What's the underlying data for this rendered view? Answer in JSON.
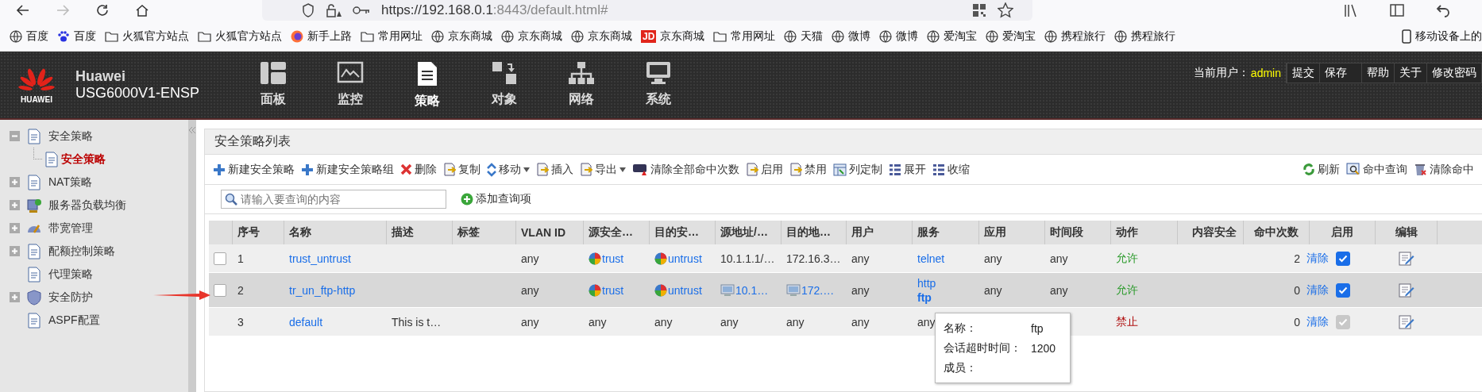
{
  "browser": {
    "address_host": "https://192.168.0.1",
    "address_rest": ":8443/default.html#",
    "forward_disabled": true
  },
  "bookmarks": [
    {
      "kind": "globe",
      "label": "百度"
    },
    {
      "kind": "paw",
      "label": "百度"
    },
    {
      "kind": "folder",
      "label": "火狐官方站点"
    },
    {
      "kind": "folder",
      "label": "火狐官方站点"
    },
    {
      "kind": "fox",
      "label": "新手上路"
    },
    {
      "kind": "folder",
      "label": "常用网址"
    },
    {
      "kind": "globe",
      "label": "京东商城"
    },
    {
      "kind": "globe",
      "label": "京东商城"
    },
    {
      "kind": "globe",
      "label": "京东商城"
    },
    {
      "kind": "jd",
      "label": "京东商城",
      "badge": "JD"
    },
    {
      "kind": "folder",
      "label": "常用网址"
    },
    {
      "kind": "globe",
      "label": "天猫"
    },
    {
      "kind": "globe",
      "label": "微博"
    },
    {
      "kind": "globe",
      "label": "微博"
    },
    {
      "kind": "globe",
      "label": "爱淘宝"
    },
    {
      "kind": "globe",
      "label": "爱淘宝"
    },
    {
      "kind": "globe",
      "label": "携程旅行"
    },
    {
      "kind": "globe",
      "label": "携程旅行"
    }
  ],
  "mobile_bookmarks": "移动设备上的",
  "header": {
    "logo_text": "HUAWEI",
    "brand": "Huawei",
    "model": "USG6000V1-ENSP",
    "nav": [
      {
        "label": "面板",
        "selected": false
      },
      {
        "label": "监控",
        "selected": false
      },
      {
        "label": "策略",
        "selected": true
      },
      {
        "label": "对象",
        "selected": false
      },
      {
        "label": "网络",
        "selected": false
      },
      {
        "label": "系统",
        "selected": false
      }
    ],
    "user_label": "当前用户：",
    "user": "admin",
    "links": [
      "提交",
      "保存",
      "帮助",
      "关于",
      "修改密码"
    ]
  },
  "sidebar": [
    {
      "kind": "group",
      "label": "安全策略",
      "expanded": true,
      "children": [
        {
          "label": "安全策略",
          "selected": true
        }
      ]
    },
    {
      "kind": "group",
      "label": "NAT策略",
      "expanded": false
    },
    {
      "kind": "group",
      "label": "服务器负载均衡",
      "expanded": false
    },
    {
      "kind": "group",
      "label": "带宽管理",
      "expanded": false
    },
    {
      "kind": "group",
      "label": "配额控制策略",
      "expanded": false
    },
    {
      "kind": "leaf",
      "label": "代理策略"
    },
    {
      "kind": "group",
      "label": "安全防护",
      "expanded": false
    },
    {
      "kind": "leaf",
      "label": "ASPF配置"
    }
  ],
  "panel_title": "安全策略列表",
  "toolbar": [
    {
      "label": "新建安全策略",
      "has_menu": false
    },
    {
      "label": "新建安全策略组",
      "has_menu": false
    },
    {
      "label": "删除",
      "has_menu": false
    },
    {
      "label": "复制",
      "has_menu": false
    },
    {
      "label": "移动",
      "has_menu": true
    },
    {
      "label": "插入",
      "has_menu": false
    },
    {
      "label": "导出",
      "has_menu": true
    },
    {
      "label": "清除全部命中次数",
      "has_menu": false
    },
    {
      "label": "启用",
      "has_menu": false
    },
    {
      "label": "禁用",
      "has_menu": false
    },
    {
      "label": "列定制",
      "has_menu": false
    },
    {
      "label": "展开",
      "has_menu": false
    },
    {
      "label": "收缩",
      "has_menu": false
    }
  ],
  "toolbar_right": [
    "刷新",
    "命中查询",
    "清除命中"
  ],
  "search": {
    "placeholder": "请输入要查询的内容"
  },
  "add_query": "添加查询项",
  "table": {
    "columns": [
      "序号",
      "名称",
      "描述",
      "标签",
      "VLAN ID",
      "源安全…",
      "目的安…",
      "源地址/…",
      "目的地…",
      "用户",
      "服务",
      "应用",
      "时间段",
      "动作",
      "内容安全",
      "命中次数",
      "启用",
      "编辑"
    ],
    "rows": [
      {
        "selectable": true,
        "checked": false,
        "highlighted": false,
        "hits": "2",
        "clear": "清除",
        "enabled": true,
        "enable_disabled": false,
        "cells": [
          {
            "kind": "text",
            "text": "1"
          },
          {
            "kind": "link",
            "text": "trust_untrust"
          },
          {
            "kind": "empty"
          },
          {
            "kind": "empty"
          },
          {
            "kind": "text",
            "text": "any"
          },
          {
            "kind": "zone",
            "text": "trust"
          },
          {
            "kind": "zone",
            "text": "untrust"
          },
          {
            "kind": "text",
            "text": "10.1.1.1/…"
          },
          {
            "kind": "text",
            "text": "172.16.3…"
          },
          {
            "kind": "text",
            "text": "any"
          },
          {
            "kind": "link",
            "text": "telnet"
          },
          {
            "kind": "text",
            "text": "any"
          },
          {
            "kind": "text",
            "text": "any"
          },
          {
            "kind": "allow",
            "text": "允许"
          },
          {
            "kind": "empty"
          }
        ]
      },
      {
        "selectable": true,
        "checked": false,
        "highlighted": true,
        "hits": "0",
        "clear": "清除",
        "enabled": true,
        "enable_disabled": false,
        "cells": [
          {
            "kind": "text",
            "text": "2"
          },
          {
            "kind": "link",
            "text": "tr_un_ftp-http"
          },
          {
            "kind": "empty"
          },
          {
            "kind": "empty"
          },
          {
            "kind": "text",
            "text": "any"
          },
          {
            "kind": "zone",
            "text": "trust"
          },
          {
            "kind": "zone",
            "text": "untrust"
          },
          {
            "kind": "addr",
            "text": "10.1…"
          },
          {
            "kind": "addr",
            "text": "172.…"
          },
          {
            "kind": "text",
            "text": "any"
          },
          {
            "kind": "services",
            "items": [
              {
                "text": "http",
                "hovered": false
              },
              {
                "text": "ftp",
                "hovered": true
              }
            ]
          },
          {
            "kind": "text",
            "text": "any"
          },
          {
            "kind": "text",
            "text": "any"
          },
          {
            "kind": "allow",
            "text": "允许"
          },
          {
            "kind": "empty"
          }
        ]
      },
      {
        "selectable": false,
        "highlighted": false,
        "hits": "0",
        "clear": "清除",
        "enabled": true,
        "enable_disabled": true,
        "cells": [
          {
            "kind": "text",
            "text": "3"
          },
          {
            "kind": "link",
            "text": "default"
          },
          {
            "kind": "text",
            "text": "This is t…"
          },
          {
            "kind": "empty"
          },
          {
            "kind": "text",
            "text": "any"
          },
          {
            "kind": "text",
            "text": "any"
          },
          {
            "kind": "text",
            "text": "any"
          },
          {
            "kind": "text",
            "text": "any"
          },
          {
            "kind": "text",
            "text": "any"
          },
          {
            "kind": "text",
            "text": "any"
          },
          {
            "kind": "text",
            "text": "any"
          },
          {
            "kind": "empty"
          },
          {
            "kind": "empty"
          },
          {
            "kind": "deny",
            "text": "禁止"
          },
          {
            "kind": "empty"
          }
        ]
      }
    ]
  },
  "tooltip": [
    {
      "label": "名称：",
      "value": "ftp"
    },
    {
      "label": "会话超时时间：",
      "value": "1200"
    },
    {
      "label": "成员："
    }
  ]
}
